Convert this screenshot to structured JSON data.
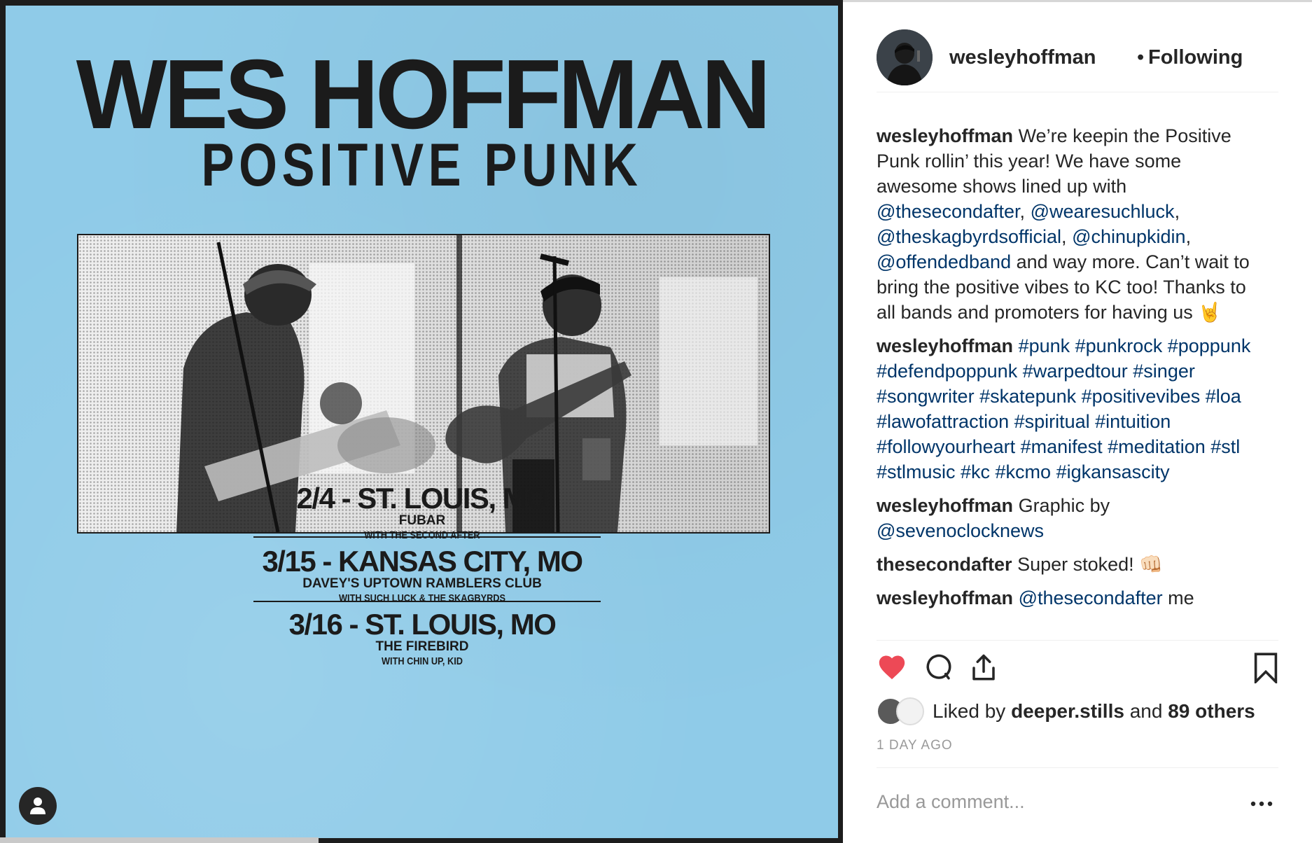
{
  "poster": {
    "artist": "WES HOFFMAN",
    "album": "POSITIVE PUNK",
    "shows": [
      {
        "date": "2/4 - ST. LOUIS, MO",
        "venue": "FUBAR",
        "with": "WITH THE SECOND AFTER"
      },
      {
        "date": "3/15 - KANSAS CITY, MO",
        "venue": "DAVEY'S UPTOWN RAMBLERS CLUB",
        "with": "WITH SUCH LUCK & THE SKAGBYRDS"
      },
      {
        "date": "3/16 - ST. LOUIS, MO",
        "venue": "THE FIREBIRD",
        "with": "WITH CHIN UP, KID"
      }
    ]
  },
  "header": {
    "username": "wesleyhoffman",
    "separator": "•",
    "follow_status": "Following"
  },
  "comments": [
    {
      "user": "wesleyhoffman",
      "parts": [
        {
          "t": " We’re keepin the Positive Punk rollin’ this year! We have some awesome shows lined up with ",
          "tag": false
        },
        {
          "t": "@thesecondafter",
          "tag": true
        },
        {
          "t": ", ",
          "tag": false
        },
        {
          "t": "@wearesuchluck",
          "tag": true
        },
        {
          "t": ", ",
          "tag": false
        },
        {
          "t": "@theskagbyrdsofficial",
          "tag": true
        },
        {
          "t": ", ",
          "tag": false
        },
        {
          "t": "@chinupkidin",
          "tag": true
        },
        {
          "t": ", ",
          "tag": false
        },
        {
          "t": "@offendedband",
          "tag": true
        },
        {
          "t": " and way more. Can’t wait to bring the positive vibes to KC too! Thanks to all bands and promoters for having us 🤘",
          "tag": false
        }
      ],
      "heart": "none"
    },
    {
      "user": "wesleyhoffman",
      "parts": [
        {
          "t": " ",
          "tag": false
        },
        {
          "t": "#punk #punkrock #poppunk #defendpoppunk #warpedtour #singer #songwriter #skatepunk #positivevibes #loa #lawofattraction #spiritual #intuition #followyourheart #manifest #meditation #stl #stlmusic #kc #kcmo #igkansascity",
          "tag": true
        }
      ],
      "heart": "outline"
    },
    {
      "user": "wesleyhoffman",
      "parts": [
        {
          "t": " Graphic by ",
          "tag": false
        },
        {
          "t": "@sevenoclocknews",
          "tag": true
        }
      ],
      "heart": "filled"
    },
    {
      "user": "thesecondafter",
      "parts": [
        {
          "t": " Super stoked! 👊🏻",
          "tag": false
        }
      ],
      "heart": "outline"
    },
    {
      "user": "wesleyhoffman",
      "parts": [
        {
          "t": " ",
          "tag": false
        },
        {
          "t": "@thesecondafter",
          "tag": true
        },
        {
          "t": " me",
          "tag": false
        }
      ],
      "heart": "outline"
    }
  ],
  "actions": {
    "like_icon": "heart-filled-icon",
    "comment_icon": "comment-bubble-icon",
    "share_icon": "share-icon",
    "save_icon": "bookmark-icon"
  },
  "likes": {
    "prefix": "Liked by ",
    "user": "deeper.stills",
    "middle": " and ",
    "others": "89 others"
  },
  "timestamp": "1 DAY AGO",
  "comment_placeholder": "Add a comment...",
  "colors": {
    "poster_bg": "#8fcbe8",
    "like_red": "#ed4956",
    "link_blue": "#003569",
    "text": "#262626",
    "muted": "#999999"
  }
}
